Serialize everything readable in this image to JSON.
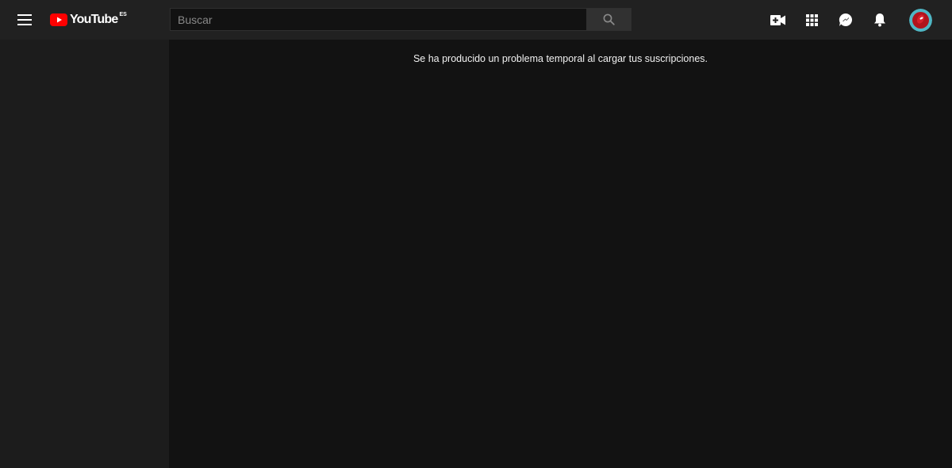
{
  "header": {
    "logo": {
      "wordmark": "YouTube",
      "region": "ES",
      "brand_color": "#FF0000"
    },
    "search": {
      "placeholder": "Buscar",
      "value": ""
    },
    "icons": {
      "menu": "hamburger-menu-icon",
      "search": "search-icon",
      "create": "video-camera-plus-icon",
      "apps": "apps-grid-icon",
      "messages": "messages-share-icon",
      "notifications": "bell-icon",
      "avatar": "user-avatar"
    }
  },
  "main": {
    "error_message": "Se ha producido un problema temporal al cargar tus suscripciones."
  },
  "colors": {
    "topbar_bg": "#212121",
    "sidebar_bg": "#1c1c1c",
    "main_bg": "#121212",
    "text": "#f1f1f1"
  }
}
